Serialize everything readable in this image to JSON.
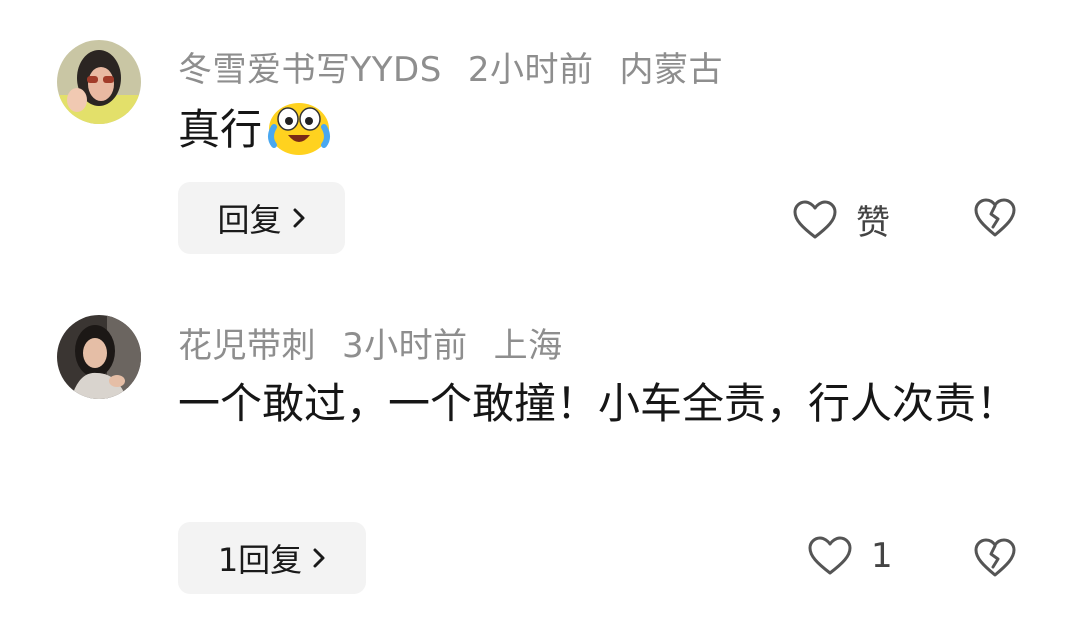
{
  "comments": [
    {
      "username": "冬雪爱书写YYDS",
      "time": "2小时前",
      "location": "内蒙古",
      "text": "真行",
      "emoji": "crying-laughing-emoji",
      "reply_label": "回复",
      "like_label": "赞",
      "icons": {
        "like": "heart-outline-icon",
        "dislike": "broken-heart-icon",
        "chevron": "chevron-right-icon"
      }
    },
    {
      "username": "花児带刺",
      "time": "3小时前",
      "location": "上海",
      "text": "一个敢过，一个敢撞！小车全责，行人次责！",
      "reply_label": "1回复",
      "like_label": "1",
      "icons": {
        "like": "heart-outline-icon",
        "dislike": "broken-heart-icon",
        "chevron": "chevron-right-icon"
      }
    }
  ],
  "colors": {
    "meta": "#8e8e8e",
    "text": "#161616",
    "button_bg": "#f3f3f3"
  }
}
